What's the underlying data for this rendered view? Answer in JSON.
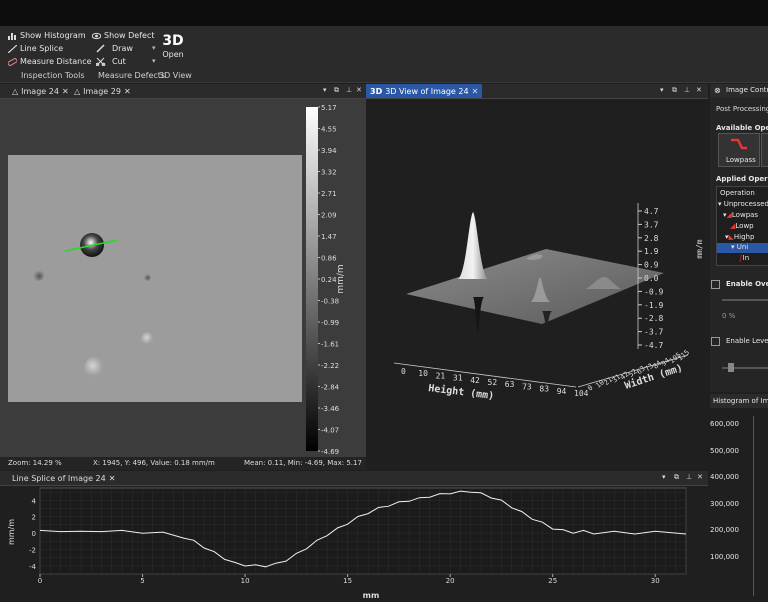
{
  "ribbon": {
    "inspection": {
      "show_histogram": "Show Histogram",
      "line_splice": "Line Splice",
      "measure_distance": "Measure Distance",
      "group_label": "Inspection Tools"
    },
    "defects": {
      "show_defect": "Show Defect",
      "draw": "Draw",
      "cut": "Cut",
      "group_label": "Measure Defects"
    },
    "view3d": {
      "icon_text": "3D",
      "open": "Open",
      "group_label": "3D View"
    }
  },
  "image_tabs": [
    {
      "label": "Image 24",
      "active": false
    },
    {
      "label": "Image 29",
      "active": false
    }
  ],
  "view3d_tab": {
    "label": "3D View of Image 24",
    "icon_text": "3D"
  },
  "image_controls": {
    "tab_label": "Image Contro",
    "post_processing": "Post Processing",
    "available_ops": "Available Opera",
    "lowpass_button": "Lowpass",
    "applied_ops": "Applied Operati",
    "operation_header": "Operation",
    "tree": [
      "Unprocessed",
      "Lowpas",
      "Lowp",
      "Highp",
      "Uni",
      "In"
    ],
    "enable_overlay": "Enable Overl",
    "percent": "0 %",
    "enable_level": "Enable Level"
  },
  "colorbar": {
    "unit": "mm/m",
    "ticks": [
      "5.17",
      "4.55",
      "3.94",
      "3.32",
      "2.71",
      "2.09",
      "1.47",
      "0.86",
      "0.24",
      "-0.38",
      "-0.99",
      "-1.61",
      "-2.22",
      "-2.84",
      "-3.46",
      "-4.07",
      "-4.69"
    ]
  },
  "status": {
    "zoom": "Zoom: 14.29 %",
    "cursor": "X: 1945, Y: 496, Value: 0.18 mm/m",
    "stats": "Mean: 0.11, Min: -4.69, Max: 5.17"
  },
  "view3d": {
    "z_ticks": [
      "4.7",
      "3.7",
      "2.8",
      "1.9",
      "0.9",
      "0.0",
      "-0.9",
      "-1.9",
      "-2.8",
      "-3.7",
      "-4.7"
    ],
    "z_unit": "mm/m",
    "x_ticks": [
      "0",
      "10",
      "21",
      "31",
      "42",
      "52",
      "63",
      "73",
      "83",
      "94",
      "104"
    ],
    "x_label": "Height (mm)",
    "y_ticks": [
      "0",
      "10",
      "21",
      "31",
      "42",
      "52",
      "63",
      "73",
      "84",
      "94",
      "105",
      "115"
    ],
    "y_label": "Width (mm)"
  },
  "line_splice": {
    "tab_label": "Line Splice of Image 24",
    "ylabel": "mm/m",
    "xlabel": "mm",
    "y_ticks": [
      "4",
      "2",
      "0",
      "-2",
      "-4"
    ],
    "x_ticks": [
      "0",
      "5",
      "10",
      "15",
      "20",
      "25",
      "30"
    ]
  },
  "histogram": {
    "tab_label": "Histogram of Imag",
    "y_ticks": [
      "600,000",
      "500,000",
      "400,000",
      "300,000",
      "200,000",
      "100,000"
    ]
  },
  "chart_data": {
    "type": "line",
    "title": "Line Splice of Image 24",
    "xlabel": "mm",
    "ylabel": "mm/m",
    "xlim": [
      0,
      31.5
    ],
    "ylim": [
      -5,
      5.5
    ],
    "grid": true,
    "series": [
      {
        "x": [
          0,
          1,
          2,
          3,
          4,
          5,
          6,
          7,
          7.5,
          8,
          8.5,
          9,
          9.5,
          10,
          10.5,
          11,
          11.5,
          12,
          12.5,
          13,
          13.5,
          14,
          14.5,
          15,
          15.5,
          16,
          16.5,
          17,
          17.5,
          18,
          18.5,
          19,
          19.5,
          20,
          20.5,
          21,
          21.5,
          22,
          22.5,
          23,
          23.5,
          24,
          24.5,
          25,
          25.5,
          26,
          26.5,
          27,
          28,
          29,
          30,
          31.5
        ],
        "y": [
          0.2,
          0.3,
          0.1,
          0.3,
          0.2,
          0.1,
          0.0,
          -0.5,
          -1.0,
          -1.7,
          -2.4,
          -3.1,
          -3.7,
          -3.9,
          -4.0,
          -4.0,
          -3.8,
          -3.3,
          -2.6,
          -1.8,
          -1.0,
          -0.2,
          0.5,
          1.2,
          1.9,
          2.5,
          3.0,
          3.4,
          3.7,
          4.0,
          4.2,
          4.5,
          4.7,
          4.9,
          5.0,
          5.1,
          4.8,
          4.4,
          3.9,
          3.2,
          2.5,
          1.8,
          1.2,
          0.6,
          0.3,
          0.1,
          0.2,
          0.0,
          0.1,
          0.0,
          0.1,
          0.0
        ]
      }
    ]
  }
}
